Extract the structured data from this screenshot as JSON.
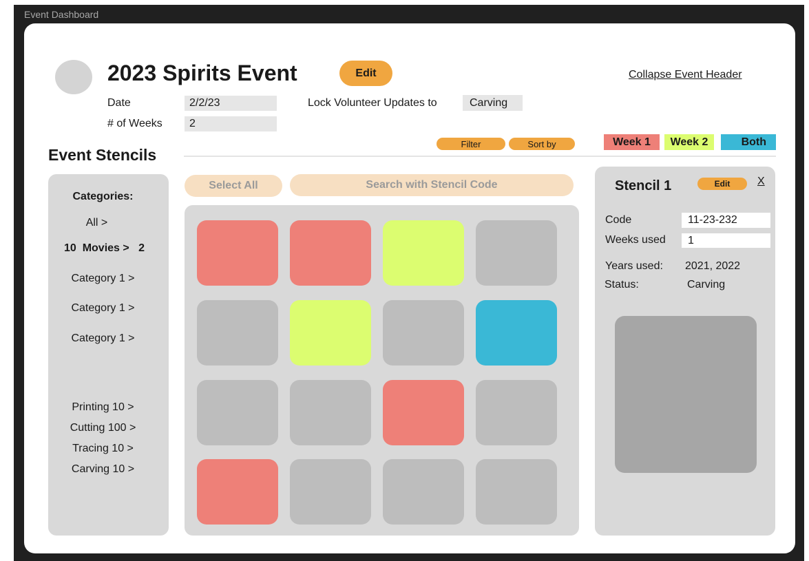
{
  "window": {
    "title": "Event Dashboard"
  },
  "header": {
    "event_title": "2023 Spirits Event",
    "edit_label": "Edit",
    "collapse_label": "Collapse Event Header",
    "date_label": "Date",
    "date_value": "2/2/23",
    "weeks_label": "# of Weeks",
    "weeks_value": "2",
    "lock_label": "Lock Volunteer Updates to",
    "lock_value": "Carving"
  },
  "toolbar": {
    "section_title": "Event Stencils",
    "filter_label": "Filter",
    "sort_label": "Sort by",
    "legend": [
      {
        "label": "Week 1",
        "color": "#ee8078"
      },
      {
        "label": "Week 2",
        "color": "#dcfd70"
      },
      {
        "label": "Both",
        "color": "#3ab8d6"
      }
    ]
  },
  "sidebar": {
    "heading": "Categories:",
    "items": [
      "All >",
      "10  Movies >   2",
      "Category 1 >",
      "Category 1 >",
      "Category 1 >"
    ],
    "stages": [
      "Printing 10 >",
      "Cutting 100 >",
      "Tracing 10 >",
      "Carving 10 >"
    ]
  },
  "main": {
    "select_all_label": "Select All",
    "search_placeholder": "Search with Stencil Code",
    "tile_colors": [
      "#ee8078",
      "#ee8078",
      "#dcfd70",
      "#bdbdbd",
      "#bdbdbd",
      "#dcfd70",
      "#bdbdbd",
      "#3ab8d6",
      "#bdbdbd",
      "#bdbdbd",
      "#ee8078",
      "#bdbdbd",
      "#ee8078",
      "#bdbdbd",
      "#bdbdbd",
      "#bdbdbd"
    ]
  },
  "detail": {
    "title": "Stencil 1",
    "edit_label": "Edit",
    "close_label": "X",
    "code_label": "Code",
    "code_value": "11-23-232",
    "weeks_used_label": "Weeks used",
    "weeks_used_value": "1",
    "years_used_label": "Years used:",
    "years_used_value": "2021, 2022",
    "status_label": "Status:",
    "status_value": "Carving"
  }
}
